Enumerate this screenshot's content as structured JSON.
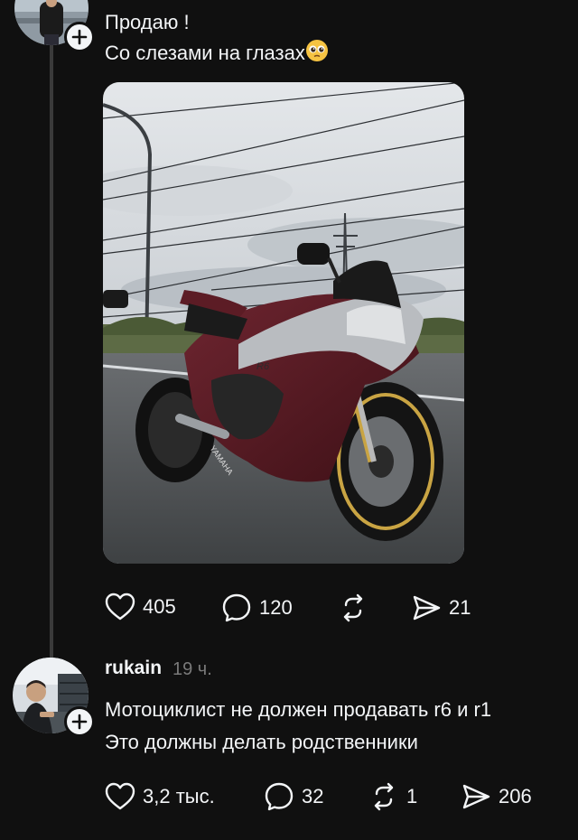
{
  "post": {
    "text_line1": "Продаю !",
    "text_line2": "Со слезами на глазах",
    "emoji": "pleading-face-emoji",
    "photo": "yamaha-r6-motorcycle-photo",
    "stats": {
      "likes": "405",
      "comments": "120",
      "reposts": "",
      "shares": "21"
    }
  },
  "reply": {
    "username": "rukain",
    "time": "19 ч.",
    "text_line1": "Мотоциклист не должен продавать r6 и r1",
    "text_line2": "Это должны делать родственники",
    "stats": {
      "likes": "3,2 тыс.",
      "comments": "32",
      "reposts": "1",
      "shares": "206"
    }
  },
  "colors": {
    "background": "#101010",
    "text": "#f3f5f7",
    "muted": "#7a7a7a",
    "thread": "#3a3a3a"
  }
}
